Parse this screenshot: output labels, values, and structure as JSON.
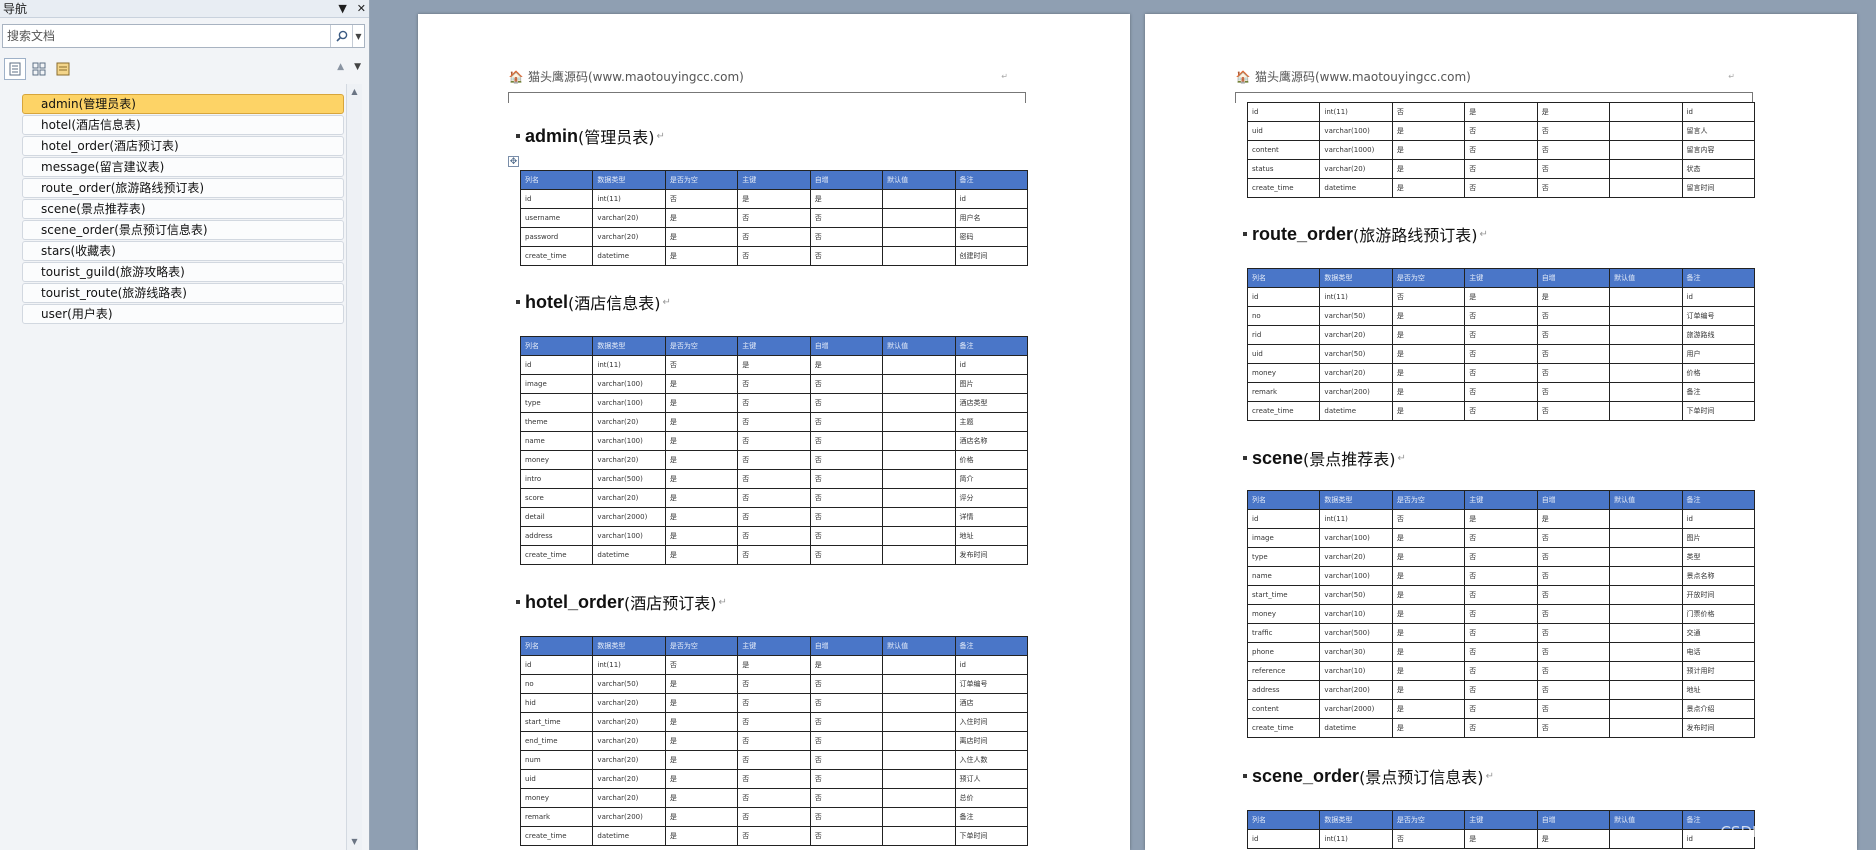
{
  "nav": {
    "title": "导航",
    "dropdown_icon": "▼",
    "close_icon": "✕",
    "search_placeholder": "搜索文档",
    "view_tabs": [
      "headings-view",
      "thumbnails-view",
      "results-view"
    ],
    "items": [
      {
        "label": "admin(管理员表)",
        "active": true
      },
      {
        "label": "hotel(酒店信息表)",
        "active": false
      },
      {
        "label": "hotel_order(酒店预订表)",
        "active": false
      },
      {
        "label": "message(留言建议表)",
        "active": false
      },
      {
        "label": "route_order(旅游路线预订表)",
        "active": false
      },
      {
        "label": "scene(景点推荐表)",
        "active": false
      },
      {
        "label": "scene_order(景点预订信息表)",
        "active": false
      },
      {
        "label": "stars(收藏表)",
        "active": false
      },
      {
        "label": "tourist_guild(旅游攻略表)",
        "active": false
      },
      {
        "label": "tourist_route(旅游线路表)",
        "active": false
      },
      {
        "label": "user(用户表)",
        "active": false
      }
    ]
  },
  "doc": {
    "header_text": "猫头鹰源码(www.maotouyingcc.com)",
    "columns": [
      "列名",
      "数据类型",
      "是否为空",
      "主键",
      "自增",
      "默认值",
      "备注"
    ],
    "page1": [
      {
        "title_en": "admin",
        "title_zh": "(管理员表)",
        "rows": [
          [
            "id",
            "int(11)",
            "否",
            "是",
            "是",
            "",
            "id"
          ],
          [
            "username",
            "varchar(20)",
            "是",
            "否",
            "否",
            "",
            "用户名"
          ],
          [
            "password",
            "varchar(20)",
            "是",
            "否",
            "否",
            "",
            "密码"
          ],
          [
            "create_time",
            "datetime",
            "是",
            "否",
            "否",
            "",
            "创建时间"
          ]
        ]
      },
      {
        "title_en": "hotel",
        "title_zh": "(酒店信息表)",
        "rows": [
          [
            "id",
            "int(11)",
            "否",
            "是",
            "是",
            "",
            "id"
          ],
          [
            "image",
            "varchar(100)",
            "是",
            "否",
            "否",
            "",
            "图片"
          ],
          [
            "type",
            "varchar(100)",
            "是",
            "否",
            "否",
            "",
            "酒店类型"
          ],
          [
            "theme",
            "varchar(20)",
            "是",
            "否",
            "否",
            "",
            "主题"
          ],
          [
            "name",
            "varchar(100)",
            "是",
            "否",
            "否",
            "",
            "酒店名称"
          ],
          [
            "money",
            "varchar(20)",
            "是",
            "否",
            "否",
            "",
            "价格"
          ],
          [
            "intro",
            "varchar(500)",
            "是",
            "否",
            "否",
            "",
            "简介"
          ],
          [
            "score",
            "varchar(20)",
            "是",
            "否",
            "否",
            "",
            "评分"
          ],
          [
            "detail",
            "varchar(2000)",
            "是",
            "否",
            "否",
            "",
            "详情"
          ],
          [
            "address",
            "varchar(100)",
            "是",
            "否",
            "否",
            "",
            "地址"
          ],
          [
            "create_time",
            "datetime",
            "是",
            "否",
            "否",
            "",
            "发布时间"
          ]
        ]
      },
      {
        "title_en": "hotel_order",
        "title_zh": "(酒店预订表)",
        "rows": [
          [
            "id",
            "int(11)",
            "否",
            "是",
            "是",
            "",
            "id"
          ],
          [
            "no",
            "varchar(50)",
            "是",
            "否",
            "否",
            "",
            "订单编号"
          ],
          [
            "hid",
            "varchar(20)",
            "是",
            "否",
            "否",
            "",
            "酒店"
          ],
          [
            "start_time",
            "varchar(20)",
            "是",
            "否",
            "否",
            "",
            "入住时间"
          ],
          [
            "end_time",
            "varchar(20)",
            "是",
            "否",
            "否",
            "",
            "离店时间"
          ],
          [
            "num",
            "varchar(20)",
            "是",
            "否",
            "否",
            "",
            "入住人数"
          ],
          [
            "uid",
            "varchar(20)",
            "是",
            "否",
            "否",
            "",
            "预订人"
          ],
          [
            "money",
            "varchar(20)",
            "是",
            "否",
            "否",
            "",
            "总价"
          ],
          [
            "remark",
            "varchar(200)",
            "是",
            "否",
            "否",
            "",
            "备注"
          ],
          [
            "create_time",
            "datetime",
            "是",
            "否",
            "否",
            "",
            "下单时间"
          ]
        ]
      }
    ],
    "page2_continued_rows": [
      [
        "id",
        "int(11)",
        "否",
        "是",
        "是",
        "",
        "id"
      ],
      [
        "uid",
        "varchar(100)",
        "是",
        "否",
        "否",
        "",
        "留言人"
      ],
      [
        "content",
        "varchar(1000)",
        "是",
        "否",
        "否",
        "",
        "留言内容"
      ],
      [
        "status",
        "varchar(20)",
        "是",
        "否",
        "否",
        "",
        "状态"
      ],
      [
        "create_time",
        "datetime",
        "是",
        "否",
        "否",
        "",
        "留言时间"
      ]
    ],
    "page2": [
      {
        "title_en": "route_order",
        "title_zh": "(旅游路线预订表)",
        "rows": [
          [
            "id",
            "int(11)",
            "否",
            "是",
            "是",
            "",
            "id"
          ],
          [
            "no",
            "varchar(50)",
            "是",
            "否",
            "否",
            "",
            "订单编号"
          ],
          [
            "rid",
            "varchar(20)",
            "是",
            "否",
            "否",
            "",
            "旅游路线"
          ],
          [
            "uid",
            "varchar(50)",
            "是",
            "否",
            "否",
            "",
            "用户"
          ],
          [
            "money",
            "varchar(20)",
            "是",
            "否",
            "否",
            "",
            "价格"
          ],
          [
            "remark",
            "varchar(200)",
            "是",
            "否",
            "否",
            "",
            "备注"
          ],
          [
            "create_time",
            "datetime",
            "是",
            "否",
            "否",
            "",
            "下单时间"
          ]
        ]
      },
      {
        "title_en": "scene",
        "title_zh": "(景点推荐表)",
        "rows": [
          [
            "id",
            "int(11)",
            "否",
            "是",
            "是",
            "",
            "id"
          ],
          [
            "image",
            "varchar(100)",
            "是",
            "否",
            "否",
            "",
            "图片"
          ],
          [
            "type",
            "varchar(20)",
            "是",
            "否",
            "否",
            "",
            "类型"
          ],
          [
            "name",
            "varchar(100)",
            "是",
            "否",
            "否",
            "",
            "景点名称"
          ],
          [
            "start_time",
            "varchar(50)",
            "是",
            "否",
            "否",
            "",
            "开放时间"
          ],
          [
            "money",
            "varchar(10)",
            "是",
            "否",
            "否",
            "",
            "门票价格"
          ],
          [
            "traffic",
            "varchar(500)",
            "是",
            "否",
            "否",
            "",
            "交通"
          ],
          [
            "phone",
            "varchar(30)",
            "是",
            "否",
            "否",
            "",
            "电话"
          ],
          [
            "reference",
            "varchar(10)",
            "是",
            "否",
            "否",
            "",
            "预计用时"
          ],
          [
            "address",
            "varchar(200)",
            "是",
            "否",
            "否",
            "",
            "地址"
          ],
          [
            "content",
            "varchar(2000)",
            "是",
            "否",
            "否",
            "",
            "景点介绍"
          ],
          [
            "create_time",
            "datetime",
            "是",
            "否",
            "否",
            "",
            "发布时间"
          ]
        ]
      },
      {
        "title_en": "scene_order",
        "title_zh": "(景点预订信息表)",
        "rows": [
          [
            "id",
            "int(11)",
            "否",
            "是",
            "是",
            "",
            "id"
          ]
        ]
      }
    ]
  },
  "watermark": "CSDN @猫头鹰源码"
}
